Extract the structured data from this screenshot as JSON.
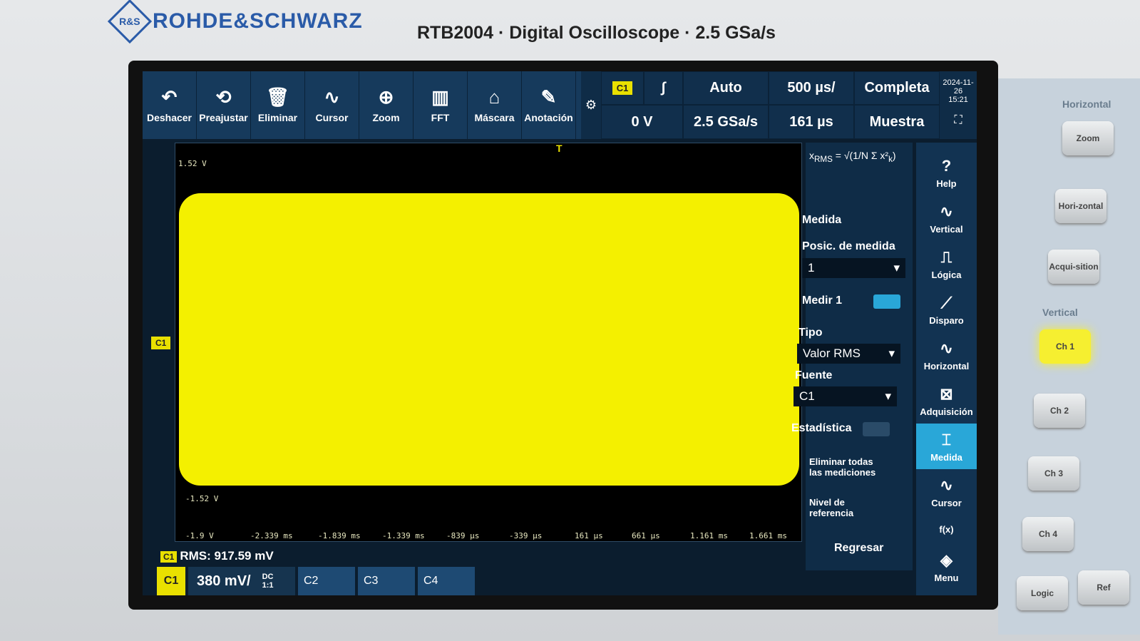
{
  "brand": {
    "logo": "R&S",
    "name": "ROHDE&SCHWARZ",
    "model": "RTB2004 · Digital Oscilloscope · 2.5 GSa/s"
  },
  "toolbar": [
    {
      "label": "Deshacer",
      "icon": "undo-icon",
      "glyph": "↶"
    },
    {
      "label": "Preajustar",
      "icon": "preset-icon",
      "glyph": "⟲"
    },
    {
      "label": "Eliminar",
      "icon": "trash-icon",
      "glyph": "🗑"
    },
    {
      "label": "Cursor",
      "icon": "cursor-icon",
      "glyph": "∿"
    },
    {
      "label": "Zoom",
      "icon": "zoom-icon",
      "glyph": "⊕"
    },
    {
      "label": "FFT",
      "icon": "fft-icon",
      "glyph": "▥"
    },
    {
      "label": "Máscara",
      "icon": "mask-icon",
      "glyph": "⌂"
    },
    {
      "label": "Anotación",
      "icon": "annotation-icon",
      "glyph": "✎"
    }
  ],
  "status": {
    "channel": "C1",
    "slope": "∫",
    "trigger_mode": "Auto",
    "timebase": "500 µs/",
    "record": "Completa",
    "level": "0 V",
    "sample_rate": "2.5 GSa/s",
    "position": "161 µs",
    "acq": "Muestra",
    "date": "2024-11-26",
    "time": "15:21"
  },
  "grid": {
    "y_top": "1.52 V",
    "y_bottom": "-1.52 V",
    "y_min": "-1.9 V",
    "x_ticks": [
      "-2.339 ms",
      "-1.839 ms",
      "-1.339 ms",
      "-839 µs",
      "-339 µs",
      "161 µs",
      "661 µs",
      "1.161 ms",
      "1.661 ms"
    ],
    "trigger": "T",
    "channel_marker": "C1"
  },
  "measurement": {
    "rms_chip": "C1",
    "rms": "RMS: 917.59 mV",
    "title": "Medida",
    "pos_label": "Posic. de medida",
    "pos_value": "1",
    "measure_label": "Medir 1",
    "type_label": "Tipo",
    "type_value": "Valor RMS",
    "source_label": "Fuente",
    "source_value": "C1",
    "stats_label": "Estadística",
    "delete_all": "Eliminar todas las mediciones",
    "ref_level": "Nivel de referencia",
    "back": "Regresar"
  },
  "channels": {
    "ch1": "C1",
    "ch1_scale": "380 mV/",
    "ch1_coupling": "DC",
    "ch1_ratio": "1:1",
    "ch2": "C2",
    "ch3": "C3",
    "ch4": "C4"
  },
  "side_menu": [
    {
      "label": "Help",
      "icon": "help-icon",
      "glyph": "?"
    },
    {
      "label": "Vertical",
      "icon": "vertical-icon",
      "glyph": "∿"
    },
    {
      "label": "Lógica",
      "icon": "logic-icon",
      "glyph": "⎍"
    },
    {
      "label": "Disparo",
      "icon": "trigger-icon",
      "glyph": "⟋"
    },
    {
      "label": "Horizontal",
      "icon": "horizontal-icon",
      "glyph": "∿"
    },
    {
      "label": "Adquisición",
      "icon": "acquisition-icon",
      "glyph": "⊠"
    },
    {
      "label": "Medida",
      "icon": "measure-icon",
      "glyph": "⌶"
    },
    {
      "label": "Cursor",
      "icon": "cursor-icon",
      "glyph": "∿"
    },
    {
      "label": "f(x)",
      "icon": "function-icon",
      "glyph": ""
    },
    {
      "label": "Menu",
      "icon": "menu-icon",
      "glyph": "◈"
    }
  ],
  "hardware": {
    "horizontal_title": "Horizontal",
    "vertical_title": "Vertical",
    "zoom": "Zoom",
    "hori": "Hori-zontal",
    "acq": "Acqui-sition",
    "ch1": "Ch 1",
    "ch2": "Ch 2",
    "ch3": "Ch 3",
    "ch4": "Ch 4",
    "logic": "Logic",
    "ref": "Ref"
  }
}
